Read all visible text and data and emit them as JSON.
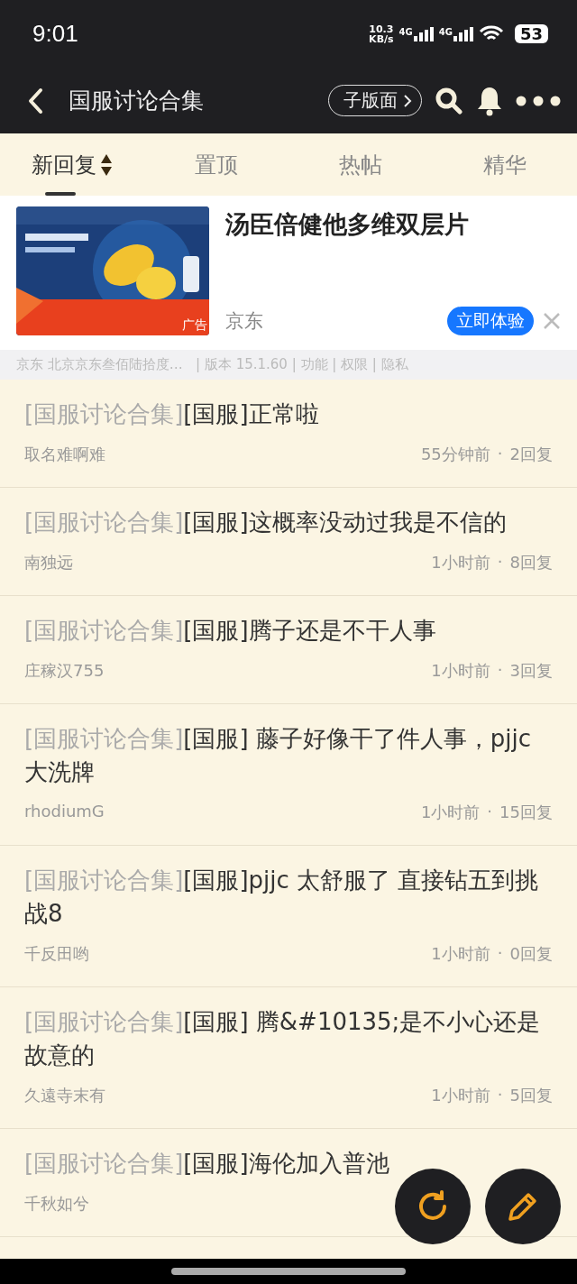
{
  "status_bar": {
    "time": "9:01",
    "speed": "10.3\nKB/s",
    "network_1": "4G",
    "network_2": "4G",
    "battery": "53"
  },
  "toolbar": {
    "title": "国服讨论合集",
    "subforum_button": "子版面"
  },
  "tabs": [
    {
      "label": "新回复",
      "selected": true,
      "sortable": true
    },
    {
      "label": "置顶",
      "selected": false,
      "sortable": false
    },
    {
      "label": "热帖",
      "selected": false,
      "sortable": false
    },
    {
      "label": "精华",
      "selected": false,
      "sortable": false
    }
  ],
  "ad": {
    "title": "汤臣倍健他多维双层片",
    "badge": "广告",
    "source": "京东",
    "cta": "立即体验",
    "footer": "京东 北京京东叁佰陆拾度…   | 版本 15.1.60 | 功能 | 权限 | 隐私"
  },
  "threads": [
    {
      "forum": "[国服讨论合集]",
      "title": "[国服]正常啦",
      "author": "取名难啊难",
      "time": "55分钟前",
      "separator": "·",
      "replies": "2回复"
    },
    {
      "forum": "[国服讨论合集]",
      "title": "[国服]这概率没动过我是不信的",
      "author": "南独远",
      "time": "1小时前",
      "separator": "·",
      "replies": "8回复"
    },
    {
      "forum": "[国服讨论合集]",
      "title": "[国服]腾子还是不干人事",
      "author": "庄稼汉755",
      "time": "1小时前",
      "separator": "·",
      "replies": "3回复"
    },
    {
      "forum": "[国服讨论合集]",
      "title": "[国服] 藤子好像干了件人事，pjjc 大洗牌",
      "author": "rhodiumG",
      "time": "1小时前",
      "separator": "·",
      "replies": "15回复"
    },
    {
      "forum": "[国服讨论合集]",
      "title": "[国服]pjjc 太舒服了 直接钻五到挑战8",
      "author": "千反田哟",
      "time": "1小时前",
      "separator": "·",
      "replies": "0回复"
    },
    {
      "forum": "[国服讨论合集]",
      "title": "[国服] 腾&#10135;是不小心还是故意的",
      "author": "久遠寺末有",
      "time": "1小时前",
      "separator": "·",
      "replies": "5回复"
    },
    {
      "forum": "[国服讨论合集]",
      "title": "[国服]海伦加入普池",
      "author": "千秋如兮"
    }
  ]
}
